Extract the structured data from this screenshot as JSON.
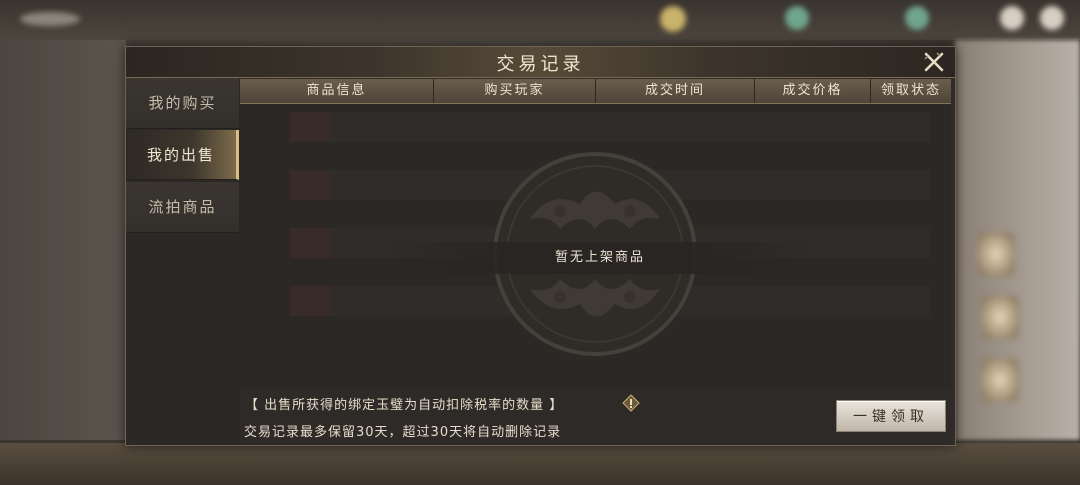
{
  "dialog": {
    "title": "交易记录",
    "close_icon": "close-icon"
  },
  "sidebar": {
    "tabs": [
      {
        "label": "我的购买",
        "active": false
      },
      {
        "label": "我的出售",
        "active": true
      },
      {
        "label": "流拍商品",
        "active": false
      }
    ]
  },
  "table": {
    "columns": [
      "商品信息",
      "购买玩家",
      "成交时间",
      "成交价格",
      "领取状态"
    ],
    "empty_message": "暂无上架商品"
  },
  "footer": {
    "note_tax": "【 出售所获得的绑定玉璧为自动扣除税率的数量 】",
    "note_retention": "交易记录最多保留30天，超过30天将自动删除记录",
    "info_icon": "info-diamond-icon",
    "claim_all_label": "一键领取"
  },
  "colors": {
    "accent_gold": "#d9be86",
    "panel_bg": "#2b2825",
    "header_bg": "#5c5042"
  }
}
